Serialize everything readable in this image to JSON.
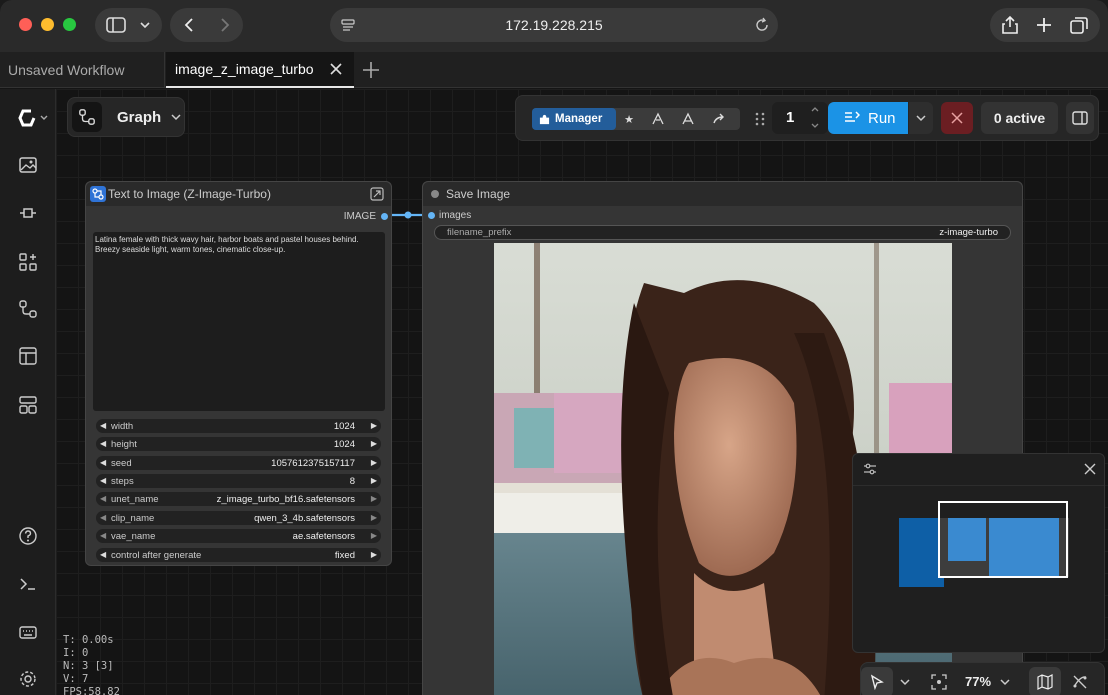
{
  "browser": {
    "url": "172.19.228.215"
  },
  "tabs": [
    {
      "label": "Unsaved Workflow"
    },
    {
      "label": "image_z_image_turbo"
    }
  ],
  "graph_button": {
    "label": "Graph"
  },
  "toolbar": {
    "manager_label": "Manager",
    "queue_count": "1",
    "run_label": "Run",
    "active_label": "0 active"
  },
  "node_t2i": {
    "title": "Text to Image (Z-Image-Turbo)",
    "output_label": "IMAGE",
    "prompt": "Latina female with thick wavy hair, harbor boats and pastel houses behind. Breezy seaside light, warm tones, cinematic close-up.",
    "widgets": [
      {
        "label": "width",
        "value": "1024"
      },
      {
        "label": "height",
        "value": "1024"
      },
      {
        "label": "seed",
        "value": "1057612375157117"
      },
      {
        "label": "steps",
        "value": "8"
      },
      {
        "label": "unet_name",
        "value": "z_image_turbo_bf16.safetensors"
      },
      {
        "label": "clip_name",
        "value": "qwen_3_4b.safetensors"
      },
      {
        "label": "vae_name",
        "value": "ae.safetensors"
      },
      {
        "label": "control after generate",
        "value": "fixed"
      }
    ]
  },
  "node_save": {
    "title": "Save Image",
    "input_label": "images",
    "filename_prefix_label": "filename_prefix",
    "filename_prefix_value": "z-image-turbo"
  },
  "bottom_bar": {
    "zoom": "77%"
  },
  "stats": {
    "t": "T: 0.00s",
    "i": "I: 0",
    "n": "N: 3 [3]",
    "v": "V: 7",
    "fps": "FPS:58.82"
  },
  "colors": {
    "accent": "#1b93e6",
    "manager": "#235d9a",
    "link": "#64b5f6",
    "stop": "#6b1e22"
  }
}
